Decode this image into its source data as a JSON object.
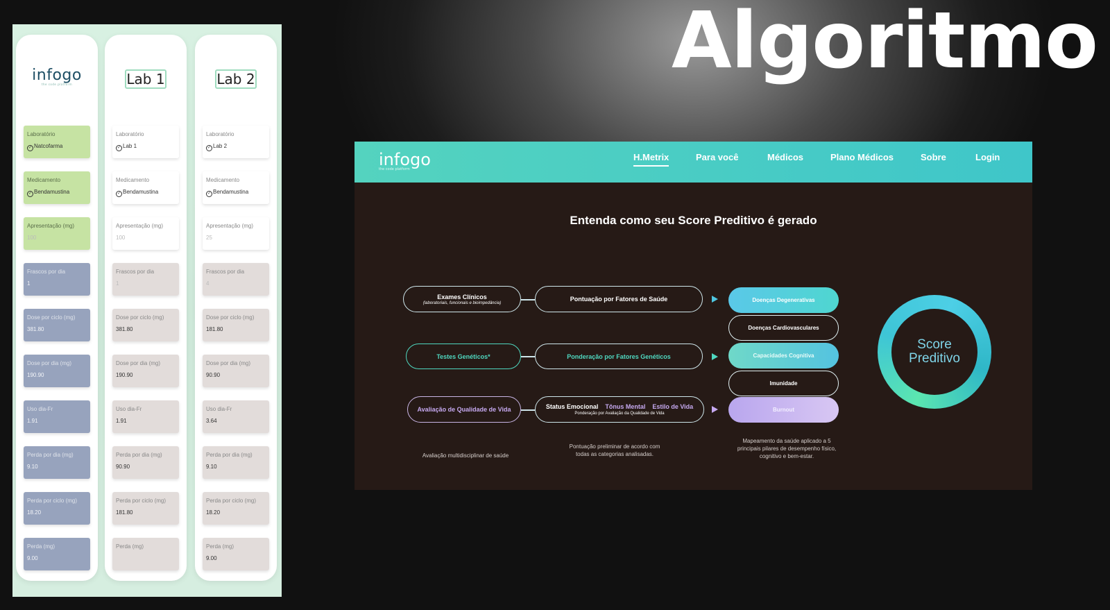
{
  "headline": "Algoritmo",
  "columns": [
    {
      "header_type": "logo",
      "logo": "infogo",
      "logo_sub": "the code platform",
      "cells": [
        {
          "label": "Laboratório",
          "value": "Natcofarma",
          "check": true,
          "color": "green"
        },
        {
          "label": "Medicamento",
          "value": "Bendamustina",
          "check": true,
          "color": "green"
        },
        {
          "label": "Apresentação (mg)",
          "value": "100",
          "placeholder": true,
          "color": "green"
        },
        {
          "label": "Frascos por dia",
          "value": "1",
          "placeholder": true,
          "color": "blue"
        },
        {
          "label": "Dose por ciclo (mg)",
          "value": "381.80",
          "color": "blue"
        },
        {
          "label": "Dose por dia (mg)",
          "value": "190.90",
          "color": "blue"
        },
        {
          "label": "Uso dia-Fr",
          "value": "1.91",
          "color": "blue"
        },
        {
          "label": "Perda por dia (mg)",
          "value": "9.10",
          "color": "blue"
        },
        {
          "label": "Perda por ciclo (mg)",
          "value": "18.20",
          "color": "blue"
        },
        {
          "label": "Perda (mg)",
          "value": "9.00",
          "color": "blue"
        }
      ]
    },
    {
      "header_type": "badge",
      "badge": "Lab 1",
      "cells": [
        {
          "label": "Laboratório",
          "value": "Lab 1",
          "check": true,
          "color": "white"
        },
        {
          "label": "Medicamento",
          "value": "Bendamustina",
          "check": true,
          "color": "white"
        },
        {
          "label": "Apresentação (mg)",
          "value": "100",
          "placeholder": true,
          "color": "white"
        },
        {
          "label": "Frascos por dia",
          "value": "1",
          "placeholder": true,
          "color": "gray"
        },
        {
          "label": "Dose por ciclo (mg)",
          "value": "381.80",
          "color": "gray"
        },
        {
          "label": "Dose por dia (mg)",
          "value": "190.90",
          "color": "gray"
        },
        {
          "label": "Uso dia-Fr",
          "value": "1.91",
          "color": "gray"
        },
        {
          "label": "Perda por dia (mg)",
          "value": "90.90",
          "color": "gray"
        },
        {
          "label": "Perda por ciclo (mg)",
          "value": "181.80",
          "color": "gray"
        },
        {
          "label": "Perda (mg)",
          "value": "",
          "color": "gray"
        }
      ]
    },
    {
      "header_type": "badge",
      "badge": "Lab 2",
      "cells": [
        {
          "label": "Laboratório",
          "value": "Lab 2",
          "check": true,
          "color": "white"
        },
        {
          "label": "Medicamento",
          "value": "Bendamustina",
          "check": true,
          "color": "white"
        },
        {
          "label": "Apresentação (mg)",
          "value": "25",
          "placeholder": true,
          "color": "white"
        },
        {
          "label": "Frascos por dia",
          "value": "4",
          "placeholder": true,
          "color": "gray"
        },
        {
          "label": "Dose por ciclo (mg)",
          "value": "181.80",
          "color": "gray"
        },
        {
          "label": "Dose por dia (mg)",
          "value": "90.90",
          "color": "gray"
        },
        {
          "label": "Uso dia-Fr",
          "value": "3.64",
          "color": "gray"
        },
        {
          "label": "Perda por dia (mg)",
          "value": "9.10",
          "color": "gray"
        },
        {
          "label": "Perda por ciclo (mg)",
          "value": "18.20",
          "color": "gray"
        },
        {
          "label": "Perda (mg)",
          "value": "9.00",
          "color": "gray"
        }
      ]
    }
  ],
  "screen": {
    "logo": "infogo",
    "logo_sub": "the code platform",
    "nav": [
      "H.Metrix",
      "Para você",
      "Médicos",
      "Plano Médicos",
      "Sobre",
      "Login"
    ],
    "title": "Entenda como seu Score Preditivo é gerado",
    "sources": [
      {
        "title": "Exames Clínicos",
        "sub": "(laboratoriais, funcionais e bioimpedância)"
      },
      {
        "title": "Testes Genéticos*",
        "sub": ""
      },
      {
        "title": "Avaliação de Qualidade de Vida",
        "sub": ""
      }
    ],
    "middle": {
      "health": "Pontuação por Fatores de Saúde",
      "genetic": "Ponderação por Fatores Genéticos",
      "emotional": "Status Emocional",
      "mental": "Tônus Mental",
      "lifestyle": "Estilo de Vida",
      "quality_sub": "Ponderação por Avaliação da Qualidade de Vida"
    },
    "categories": [
      "Doenças Degenerativas",
      "Doenças Cardiovasculares",
      "Capacidades Cognitiva",
      "Imunidade",
      "Burnout"
    ],
    "score": "Score Preditivo",
    "footer": {
      "left": "Avaliação multidisciplinar de saúde",
      "mid": "Pontuação preliminar de acordo com todas as categorias analisadas.",
      "right": "Mapeamento da saúde aplicado a 5 principais pilares de desempenho físico, cognitivo e bem-estar."
    },
    "colors": {
      "nav_start": "#54d3bf",
      "nav_end": "#3fc6c9",
      "background": "#261a16",
      "teal": "#4fd8c0",
      "violet": "#c6a9f0"
    }
  }
}
